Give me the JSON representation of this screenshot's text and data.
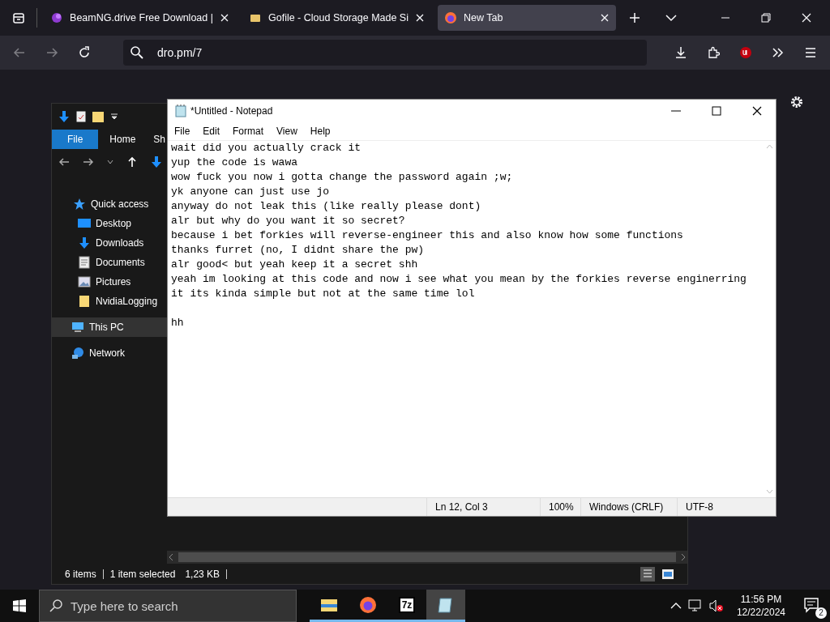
{
  "browser": {
    "tabs": [
      {
        "kind": "beamng",
        "title": "BeamNG.drive Free Download |",
        "selected": false
      },
      {
        "kind": "gofile",
        "title": "Gofile - Cloud Storage Made Si",
        "selected": false
      },
      {
        "kind": "firefox",
        "title": "New Tab",
        "selected": true
      }
    ],
    "nav_buttons": [
      {
        "kind": "back",
        "disabled": true
      },
      {
        "kind": "forward",
        "disabled": true
      },
      {
        "kind": "reload",
        "disabled": false
      }
    ],
    "url": "dro.pm/7"
  },
  "explorer": {
    "ribbon_tabs": [
      {
        "label": "File",
        "selected": true
      },
      {
        "label": "Home",
        "selected": false
      },
      {
        "label": "Sh",
        "selected": false
      }
    ],
    "nav_pane": [
      {
        "kind": "star",
        "label": "Quick access",
        "selected": false,
        "children": [
          {
            "kind": "desktop",
            "label": "Desktop",
            "selected": false
          },
          {
            "kind": "download",
            "label": "Downloads",
            "selected": false
          },
          {
            "kind": "document",
            "label": "Documents",
            "selected": false
          },
          {
            "kind": "picture",
            "label": "Pictures",
            "selected": false
          },
          {
            "kind": "folder",
            "label": "NvidiaLogging",
            "selected": false
          }
        ]
      },
      {
        "kind": "pc",
        "label": "This PC",
        "selected": true
      },
      {
        "kind": "network",
        "label": "Network",
        "selected": false
      }
    ],
    "status": {
      "items": "6 items",
      "selection": "1 item selected",
      "size": "1,23 KB"
    }
  },
  "notepad": {
    "title": "*Untitled - Notepad",
    "menu": [
      "File",
      "Edit",
      "Format",
      "View",
      "Help"
    ],
    "text": "wait did you actually crack it\nyup the code is wawa\nwow fuck you now i gotta change the password again ;w;\nyk anyone can just use jo\nanyway do not leak this (like really please dont)\nalr but why do you want it so secret?\nbecause i bet forkies will reverse-engineer this and also know how some functions\nthanks furret (no, I didnt share the pw)\nalr good< but yeah keep it a secret shh\nyeah im looking at this code and now i see what you mean by the forkies reverse enginerring\nit its kinda simple but not at the same time lol\n\nhh",
    "status": [
      "Ln 12, Col 3",
      "100%",
      "Windows (CRLF)",
      "UTF-8"
    ]
  },
  "taskbar": {
    "search": {
      "placeholder": "Type here to search"
    },
    "apps": [
      {
        "kind": "explorer",
        "selected": false
      },
      {
        "kind": "firefox",
        "selected": false
      },
      {
        "kind": "sevenzip",
        "label": "7z",
        "selected": false
      },
      {
        "kind": "notepad",
        "selected": true
      }
    ],
    "time": "11:56 PM",
    "date": "12/22/2024",
    "notifications": "2"
  }
}
